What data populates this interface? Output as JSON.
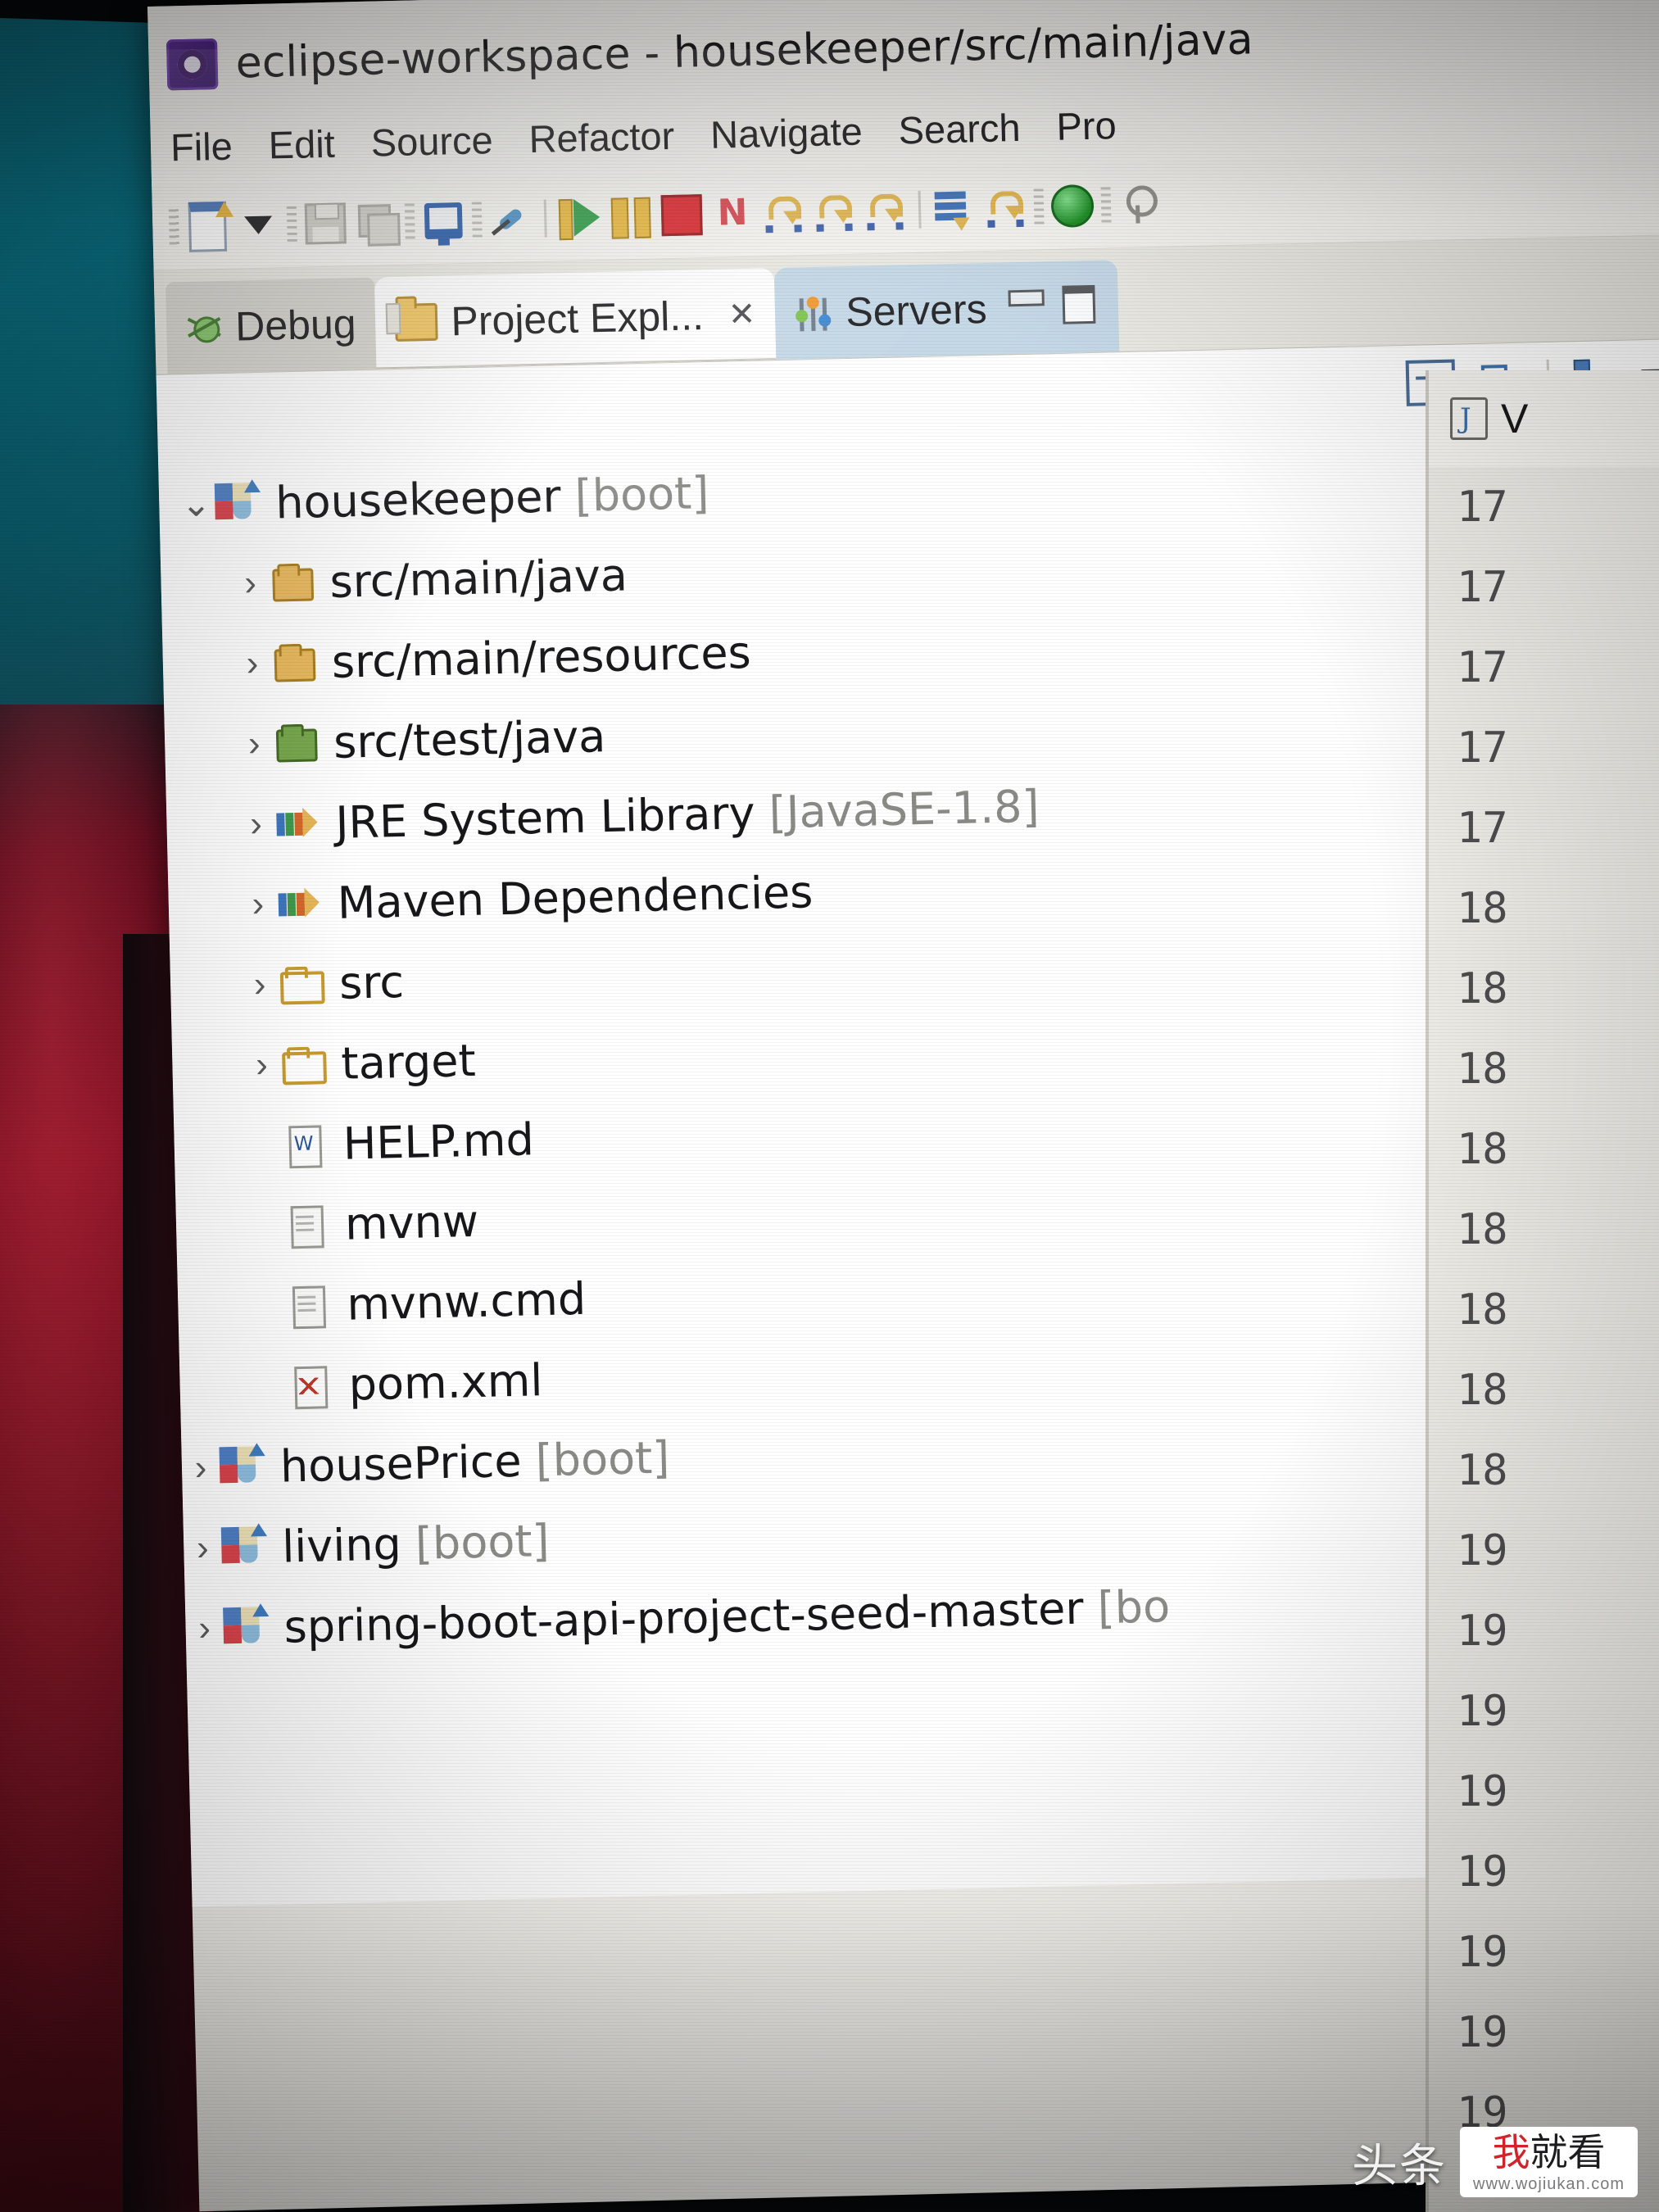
{
  "window": {
    "title": "eclipse-workspace - housekeeper/src/main/java",
    "logo_icon": "eclipse-logo-icon"
  },
  "menubar": {
    "items": [
      "File",
      "Edit",
      "Source",
      "Refactor",
      "Navigate",
      "Search",
      "Pro"
    ]
  },
  "toolbar": {
    "icons": [
      "new-file-icon",
      "dropdown-caret-icon",
      "save-icon",
      "save-all-icon",
      "console-icon",
      "skip-breakpoints-icon",
      "run-icon",
      "suspend-icon",
      "terminate-icon",
      "disconnect-icon",
      "step-into-icon",
      "step-over-icon",
      "step-return-icon",
      "show-logical-structure-icon",
      "use-step-filters-icon",
      "open-perspective-icon",
      "search-icon"
    ]
  },
  "view_tabs": [
    {
      "label": "Debug",
      "icon": "bug-icon",
      "state": "inactive",
      "closeable": false
    },
    {
      "label": "Project Expl...",
      "icon": "project-explorer-icon",
      "state": "active",
      "closeable": true,
      "close_glyph": "✕"
    },
    {
      "label": "Servers",
      "icon": "servers-icon",
      "state": "background",
      "closeable": false
    }
  ],
  "view_toolbar": {
    "icons": [
      "collapse-all-icon",
      "link-with-editor-icon",
      "view-hierarchy-icon",
      "view-menu-icon"
    ]
  },
  "tree": {
    "items": [
      {
        "label": "housekeeper",
        "suffix": " [boot]",
        "indent": 0,
        "arrow": "⌄",
        "expanded": true,
        "icon": "spring-boot-project-icon"
      },
      {
        "label": "src/main/java",
        "suffix": "",
        "indent": 1,
        "arrow": "›",
        "expanded": false,
        "icon": "source-folder-icon"
      },
      {
        "label": "src/main/resources",
        "suffix": "",
        "indent": 1,
        "arrow": "›",
        "expanded": false,
        "icon": "source-folder-icon"
      },
      {
        "label": "src/test/java",
        "suffix": "",
        "indent": 1,
        "arrow": "›",
        "expanded": false,
        "icon": "source-folder-green-icon"
      },
      {
        "label": "JRE System Library",
        "suffix": " [JavaSE-1.8]",
        "indent": 1,
        "arrow": "›",
        "expanded": false,
        "icon": "library-icon"
      },
      {
        "label": "Maven Dependencies",
        "suffix": "",
        "indent": 1,
        "arrow": "›",
        "expanded": false,
        "icon": "library-icon"
      },
      {
        "label": "src",
        "suffix": "",
        "indent": 1,
        "arrow": "›",
        "expanded": false,
        "icon": "folder-icon"
      },
      {
        "label": "target",
        "suffix": "",
        "indent": 1,
        "arrow": "›",
        "expanded": false,
        "icon": "folder-icon"
      },
      {
        "label": "HELP.md",
        "suffix": "",
        "indent": 1,
        "arrow": "",
        "expanded": false,
        "icon": "markdown-file-icon"
      },
      {
        "label": "mvnw",
        "suffix": "",
        "indent": 1,
        "arrow": "",
        "expanded": false,
        "icon": "file-icon"
      },
      {
        "label": "mvnw.cmd",
        "suffix": "",
        "indent": 1,
        "arrow": "",
        "expanded": false,
        "icon": "file-icon"
      },
      {
        "label": "pom.xml",
        "suffix": "",
        "indent": 1,
        "arrow": "",
        "expanded": false,
        "icon": "xml-file-icon"
      },
      {
        "label": "housePrice",
        "suffix": " [boot]",
        "indent": 0,
        "arrow": "›",
        "expanded": false,
        "icon": "spring-boot-project-icon"
      },
      {
        "label": "living",
        "suffix": " [boot]",
        "indent": 0,
        "arrow": "›",
        "expanded": false,
        "icon": "spring-boot-project-icon"
      },
      {
        "label": "spring-boot-api-project-seed-master",
        "suffix": " [bo",
        "indent": 0,
        "arrow": "›",
        "expanded": false,
        "icon": "spring-boot-project-icon"
      }
    ]
  },
  "editor": {
    "tab_label": "V",
    "tab_icon": "java-file-icon",
    "line_numbers": [
      "17",
      "17",
      "17",
      "17",
      "17",
      "18",
      "18",
      "18",
      "18",
      "18",
      "18",
      "18",
      "18",
      "19",
      "19",
      "19",
      "19",
      "19",
      "19",
      "19",
      "19"
    ]
  },
  "watermark": {
    "cn_text": "头条",
    "brand_red": "我",
    "brand_black": "就看",
    "url": "www.wojiukan.com"
  },
  "colors": {
    "accent_blue": "#3a6fb8",
    "active_tab": "#ffffff",
    "servers_tab": "#c3d7e6",
    "chrome": "#f2f1ec",
    "bg_teal": "#0a6c7e",
    "bg_red": "#8d0f24"
  }
}
